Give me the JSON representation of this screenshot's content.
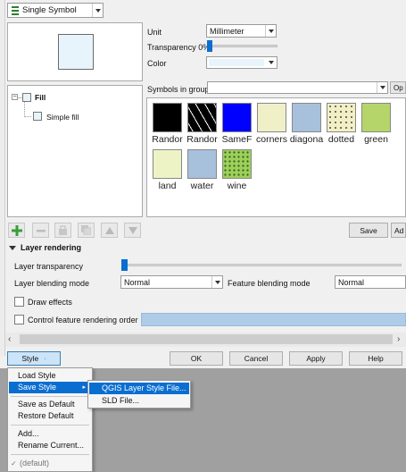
{
  "renderer": {
    "value": "Single Symbol"
  },
  "symbol": {
    "preview_color": "#e8f4fc"
  },
  "props": {
    "unit_label": "Unit",
    "unit_value": "Millimeter",
    "transparency_label": "Transparency 0%",
    "color_label": "Color",
    "color_value": "#e8f4fc"
  },
  "tree": {
    "root": "Fill",
    "child": "Simple fill"
  },
  "group": {
    "label": "Symbols in group",
    "open_label": "Op"
  },
  "symbols": [
    {
      "label": "Randor",
      "color": "#000000",
      "pattern": "solid"
    },
    {
      "label": "Randor",
      "color": "#000000",
      "pattern": "dashes"
    },
    {
      "label": "SameF",
      "color": "#0000ff",
      "pattern": "solid"
    },
    {
      "label": "corners",
      "color": "#f0f0c8",
      "pattern": "solid"
    },
    {
      "label": "diagona",
      "color": "#a7c0dc",
      "pattern": "solid"
    },
    {
      "label": "dotted",
      "color": "#f2efc4",
      "pattern": "dots"
    },
    {
      "label": "green",
      "color": "#b5d56a",
      "pattern": "solid"
    },
    {
      "label": "land",
      "color": "#eef3c6",
      "pattern": "solid"
    },
    {
      "label": "water",
      "color": "#a7c0dc",
      "pattern": "solid"
    },
    {
      "label": "wine",
      "color": "#9fcf5a",
      "pattern": "vines"
    }
  ],
  "buttons": {
    "save": "Save",
    "advanced": "Ad",
    "ok": "OK",
    "cancel": "Cancel",
    "apply": "Apply",
    "help": "Help",
    "style": "Style"
  },
  "layer_rendering": {
    "title": "Layer rendering",
    "transparency_label": "Layer transparency",
    "blending_label": "Layer blending mode",
    "blending_value": "Normal",
    "feature_blending_label": "Feature blending mode",
    "feature_blending_value": "Normal",
    "draw_effects": "Draw effects",
    "control_order": "Control feature rendering order"
  },
  "style_menu": {
    "load": "Load Style",
    "save": "Save Style",
    "save_default": "Save as Default",
    "restore_default": "Restore Default",
    "add": "Add...",
    "rename": "Rename Current...",
    "default_item": "(default)"
  },
  "save_submenu": {
    "qgis_file": "QGIS Layer Style File...",
    "sld_file": "SLD File..."
  }
}
